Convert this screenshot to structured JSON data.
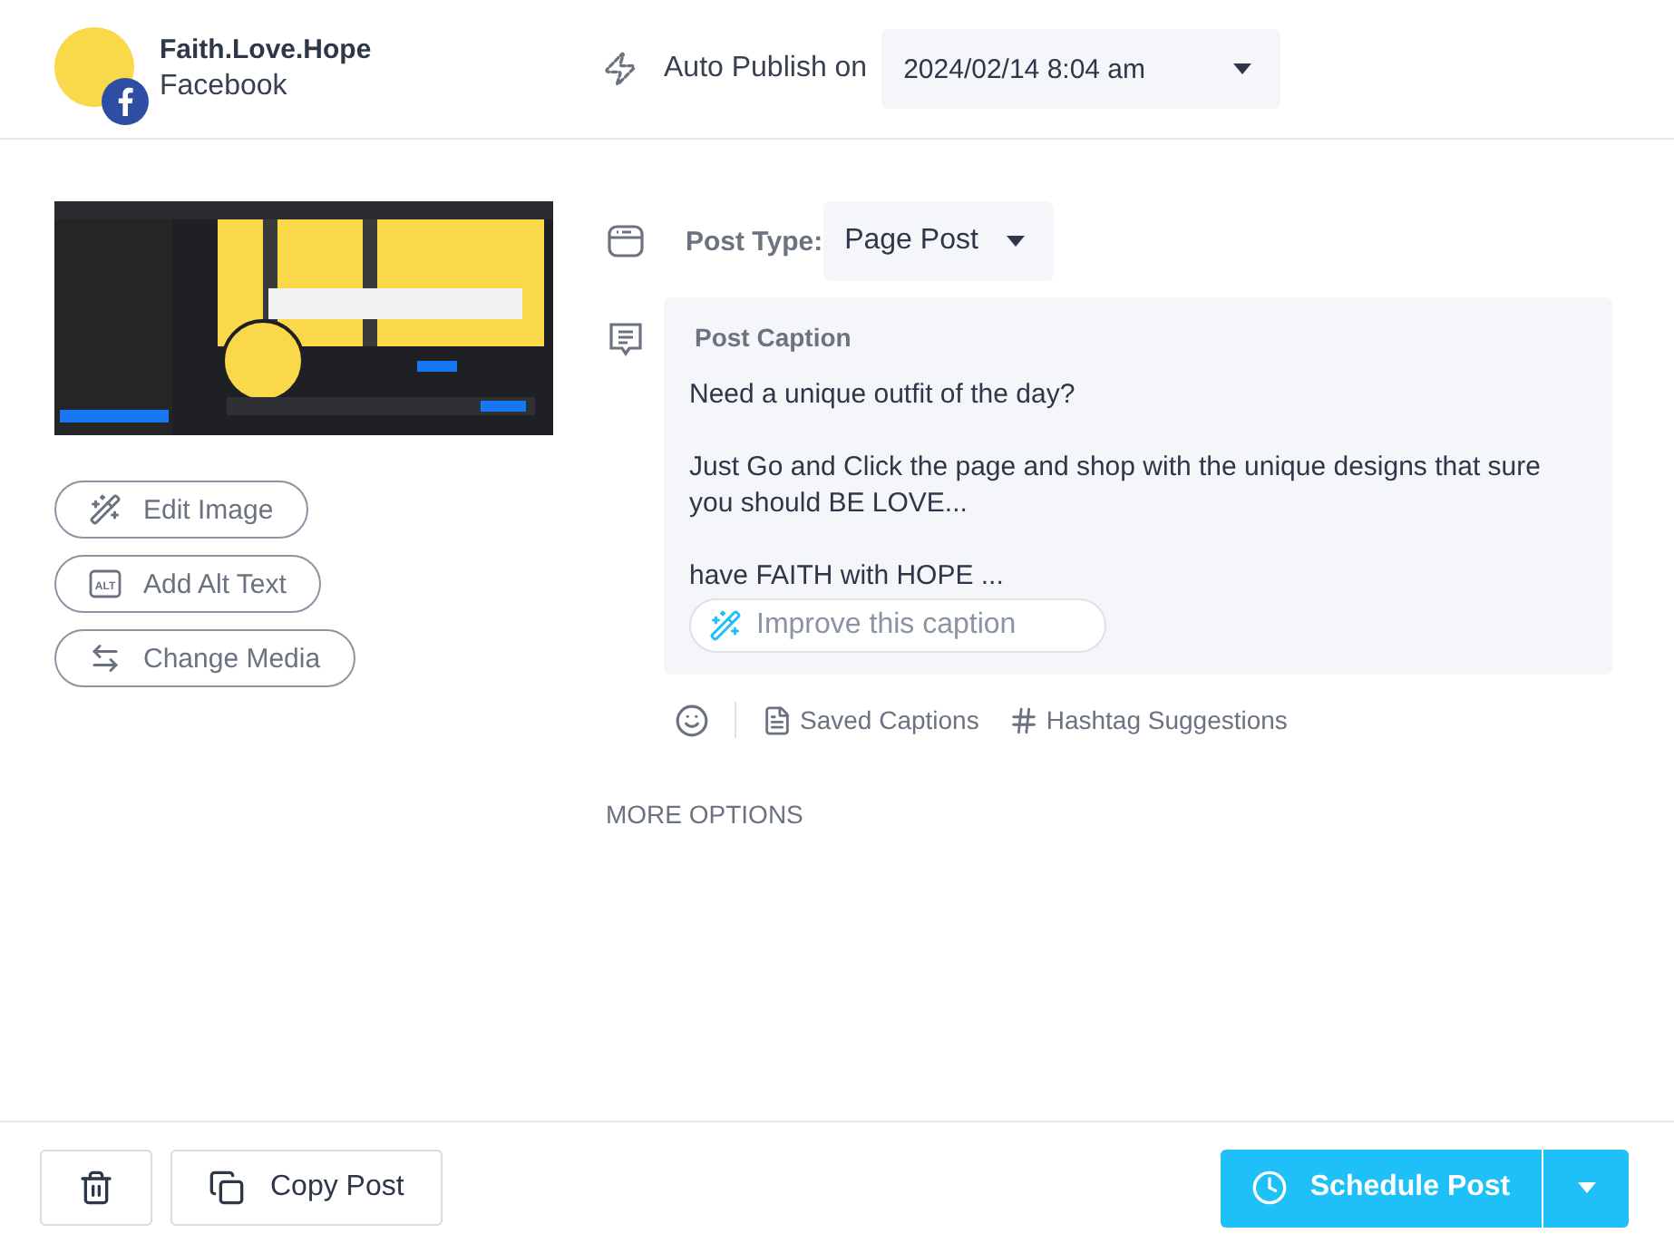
{
  "account": {
    "name": "Faith.Love.Hope",
    "network": "Facebook"
  },
  "publish": {
    "label": "Auto Publish on",
    "date": "2024/02/14 8:04 am"
  },
  "media_actions": [
    {
      "kind": "edit",
      "label": "Edit Image"
    },
    {
      "kind": "alt",
      "label": "Add Alt Text",
      "icon_text": "ALT"
    },
    {
      "kind": "change",
      "label": "Change Media"
    }
  ],
  "post_type": {
    "label": "Post Type:",
    "value": "Page Post"
  },
  "caption": {
    "label": "Post Caption",
    "paragraphs": [
      "Need a unique outfit of the day?",
      "Just Go and Click the page and shop with the unique designs that sure you should BE LOVE...",
      "have FAITH with HOPE ..."
    ],
    "improve": "Improve this caption"
  },
  "caption_tools": [
    {
      "kind": "saved",
      "label": "Saved Captions"
    },
    {
      "kind": "hashtag",
      "label": "Hashtag Suggestions"
    }
  ],
  "more_options": "MORE OPTIONS",
  "footer": {
    "copy": "Copy Post",
    "schedule": "Schedule Post"
  }
}
